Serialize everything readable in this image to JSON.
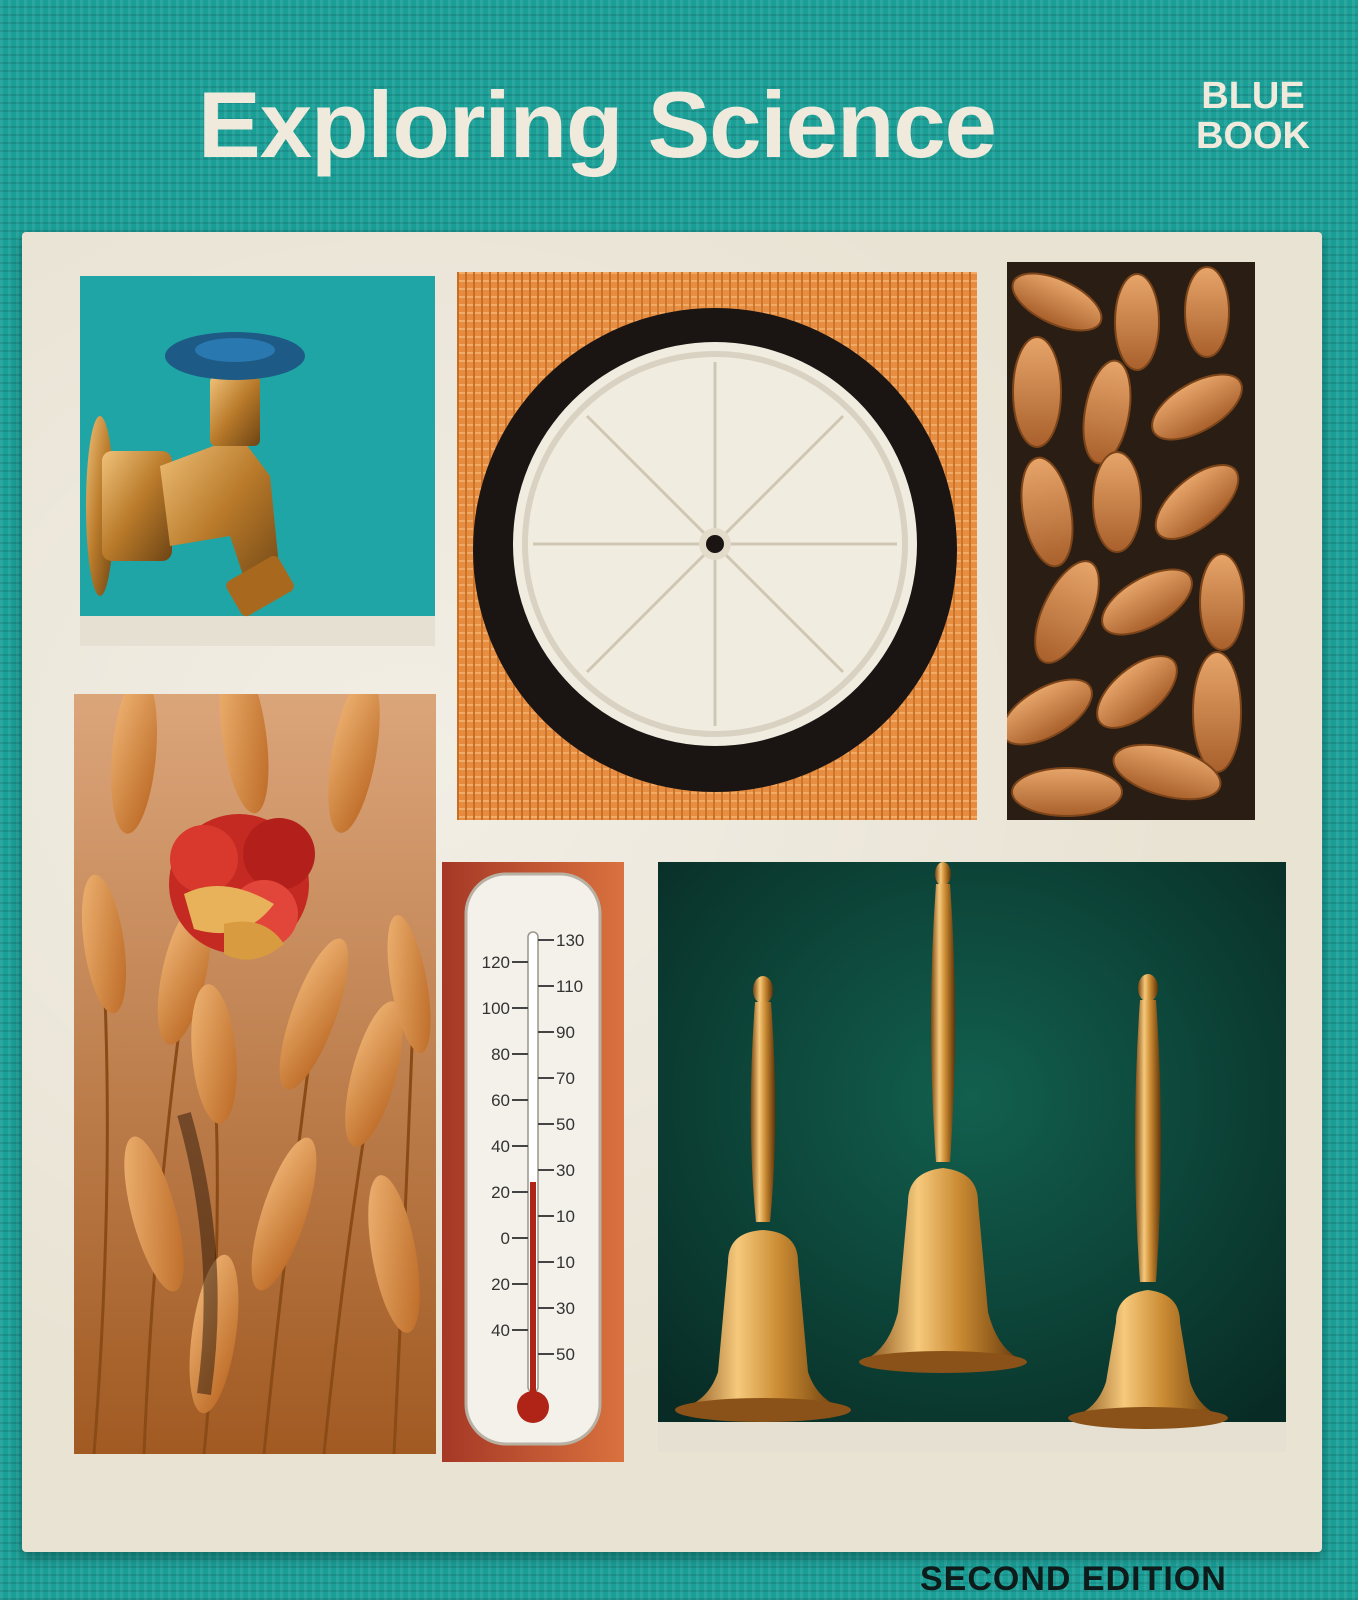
{
  "cover": {
    "title": "Exploring Science",
    "series_badge_line1": "BLUE",
    "series_badge_line2": "BOOK",
    "edition": "SECOND EDITION"
  },
  "thermometer": {
    "left_scale": [
      "120",
      "100",
      "80",
      "60",
      "40",
      "20",
      "0",
      "20",
      "40"
    ],
    "right_scale": [
      "130",
      "110",
      "90",
      "70",
      "50",
      "30",
      "10",
      "10",
      "30",
      "50"
    ]
  },
  "colors": {
    "cover_teal": "#1a9f97",
    "title_cream": "#efeadb",
    "case_white": "#e9e3d4",
    "brass": "#c98a32",
    "bell_backdrop": "#0f4a3e"
  },
  "icons": [
    "faucet-icon",
    "wheel-icon",
    "peanuts-icon",
    "wheat-icon",
    "flower-icon",
    "thermometer-icon",
    "bell-icon"
  ]
}
